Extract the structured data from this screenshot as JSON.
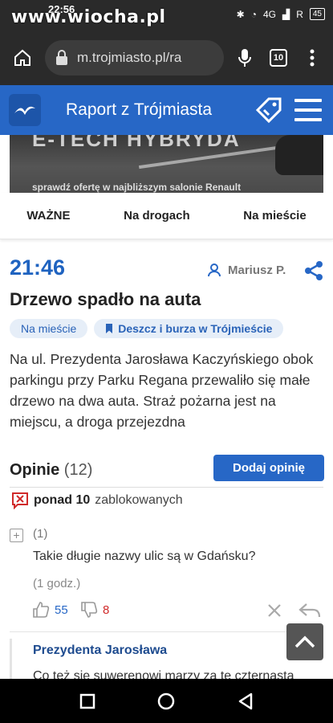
{
  "status": {
    "watermark": "www.wiocha.pl",
    "time": "22:56",
    "network": "4G",
    "carrier": "R",
    "battery": "45"
  },
  "browser": {
    "url": "m.trojmiasto.pl/ra",
    "tab_count": "10"
  },
  "site": {
    "title": "Raport z Trójmiasta"
  },
  "banner": {
    "headline": "E-TECH HYBRYDA",
    "subtext": "sprawdź ofertę w najbliższym salonie Renault"
  },
  "tabs": [
    {
      "label": "WAŻNE"
    },
    {
      "label": "Na drogach"
    },
    {
      "label": "Na mieście"
    }
  ],
  "article": {
    "time": "21:46",
    "author": "Mariusz P.",
    "title": "Drzewo spadło na auta",
    "chips": [
      "Na mieście",
      "Deszcz i burza w Trójmieście"
    ],
    "body": "Na ul. Prezydenta Jarosława Kaczyńskiego obok parkingu przy Parku Regana przewaliło się małe drzewo na dwa auta. Straż pożarna jest na miejscu, a droga przejezdna"
  },
  "comments": {
    "heading": "Opinie",
    "count": "(12)",
    "add_label": "Dodaj opinię",
    "blocked_bold": "ponad 10",
    "blocked_rest": "zablokowanych",
    "items": [
      {
        "num": "(1)",
        "text": "Takie długie nazwy ulic są w Gdańsku?",
        "age": "(1 godz.)",
        "up": "55",
        "down": "8"
      }
    ],
    "reply": {
      "author": "Prezydenta Jarosława",
      "text": "Co też się suwerenowi marzy za te czternasta"
    }
  },
  "colors": {
    "brand": "#2767c6",
    "downvote": "#d02a2a"
  },
  "icons": [
    "home-icon",
    "lock-icon",
    "mic-icon",
    "tabs-icon",
    "more-icon",
    "seagull-logo-icon",
    "tag-icon",
    "hamburger-icon",
    "user-icon",
    "share-icon",
    "bookmark-icon",
    "blocked-icon",
    "expand-icon",
    "thumb-up-icon",
    "thumb-down-icon",
    "close-icon",
    "reply-icon",
    "chevron-up-icon",
    "nav-recents-icon",
    "nav-home-icon",
    "nav-back-icon"
  ]
}
